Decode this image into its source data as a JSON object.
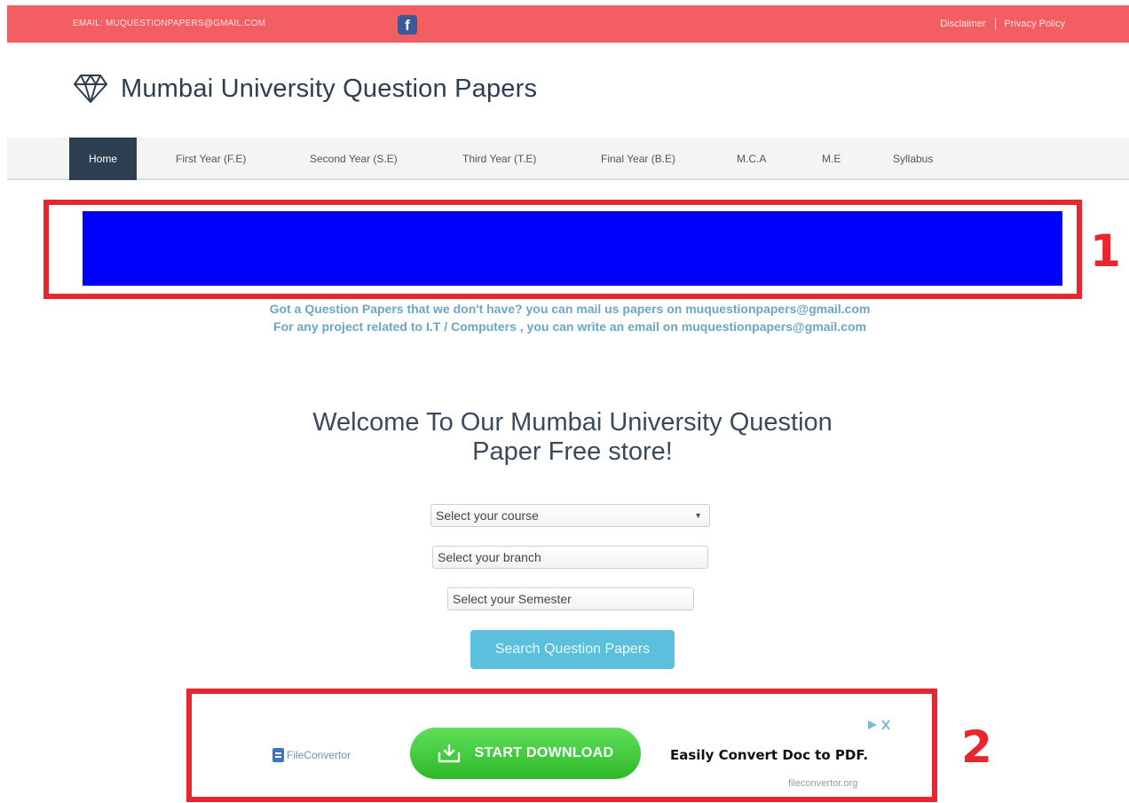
{
  "topbar": {
    "email": "EMAIL: MUQUESTIONPAPERS@GMAIL.COM",
    "facebook_glyph": "f",
    "links": [
      "Disclaimer",
      "Privacy Policy"
    ],
    "background": "#f25e62"
  },
  "brand": {
    "title": "Mumbai University Question Papers",
    "icon": "diamond-icon"
  },
  "nav": {
    "items": [
      "Home",
      "First Year (F.E)",
      "Second Year (S.E)",
      "Third Year (T.E)",
      "Final Year (B.E)",
      "M.C.A",
      "M.E",
      "Syllabus"
    ],
    "active": "Home",
    "active_color": "#2c3e50"
  },
  "annotations": {
    "label_1": "1",
    "label_2": "2",
    "color": "#e8262f"
  },
  "banner": {
    "color": "#0000ff"
  },
  "info": {
    "line1": "Got a Question Papers that we don't have? you can mail us papers on muquestionpapers@gmail.com",
    "line2": "For any project related to I.T / Computers , you can write an email on muquestionpapers@gmail.com"
  },
  "welcome": {
    "line1": "Welcome To Our Mumbai University Question",
    "line2": "Paper Free store!"
  },
  "form": {
    "course": "Select your course",
    "branch": "Select your branch",
    "semester": "Select your Semester",
    "search_label": "Search Question Papers",
    "search_color": "#5bc0de"
  },
  "ad": {
    "logo_prefix": "File",
    "logo_suffix": "Convertor",
    "button_label": "START DOWNLOAD",
    "headline": "Easily Convert Doc to PDF.",
    "url": "fileconvertor.org",
    "button_color": "#2eb82a"
  }
}
